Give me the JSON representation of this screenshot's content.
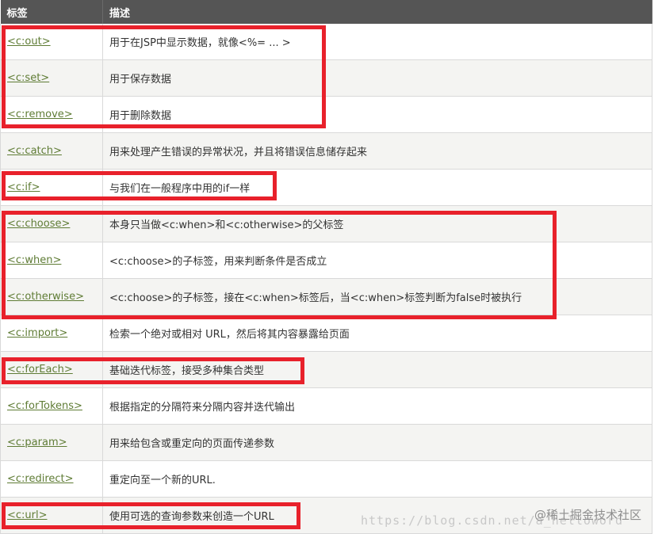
{
  "header": {
    "tag": "标签",
    "description": "描述"
  },
  "rows": [
    {
      "tag": "<c:out>",
      "description": "用于在JSP中显示数据，就像<%= ... >"
    },
    {
      "tag": "<c:set>",
      "description": "用于保存数据"
    },
    {
      "tag": "<c:remove>",
      "description": "用于删除数据"
    },
    {
      "tag": "<c:catch>",
      "description": "用来处理产生错误的异常状况，并且将错误信息储存起来"
    },
    {
      "tag": "<c:if>",
      "description": "与我们在一般程序中用的if一样"
    },
    {
      "tag": "<c:choose>",
      "description": "本身只当做<c:when>和<c:otherwise>的父标签"
    },
    {
      "tag": "<c:when>",
      "description": "<c:choose>的子标签，用来判断条件是否成立"
    },
    {
      "tag": "<c:otherwise>",
      "description": "<c:choose>的子标签，接在<c:when>标签后，当<c:when>标签判断为false时被执行"
    },
    {
      "tag": "<c:import>",
      "description": "检索一个绝对或相对 URL，然后将其内容暴露给页面"
    },
    {
      "tag": "<c:forEach>",
      "description": "基础迭代标签，接受多种集合类型"
    },
    {
      "tag": "<c:forTokens>",
      "description": "根据指定的分隔符来分隔内容并迭代输出"
    },
    {
      "tag": "<c:param>",
      "description": "用来给包含或重定向的页面传递参数"
    },
    {
      "tag": "<c:redirect>",
      "description": "重定向至一个新的URL."
    },
    {
      "tag": "<c:url>",
      "description": "使用可选的查询参数来创造一个URL"
    }
  ],
  "watermark": {
    "url": "https://blog.csdn.net/a_helloword",
    "site": "@稀土掘金技术社区"
  },
  "colors": {
    "highlight": "#e8212b",
    "link": "#5f7c35",
    "header_bg": "#555555"
  }
}
